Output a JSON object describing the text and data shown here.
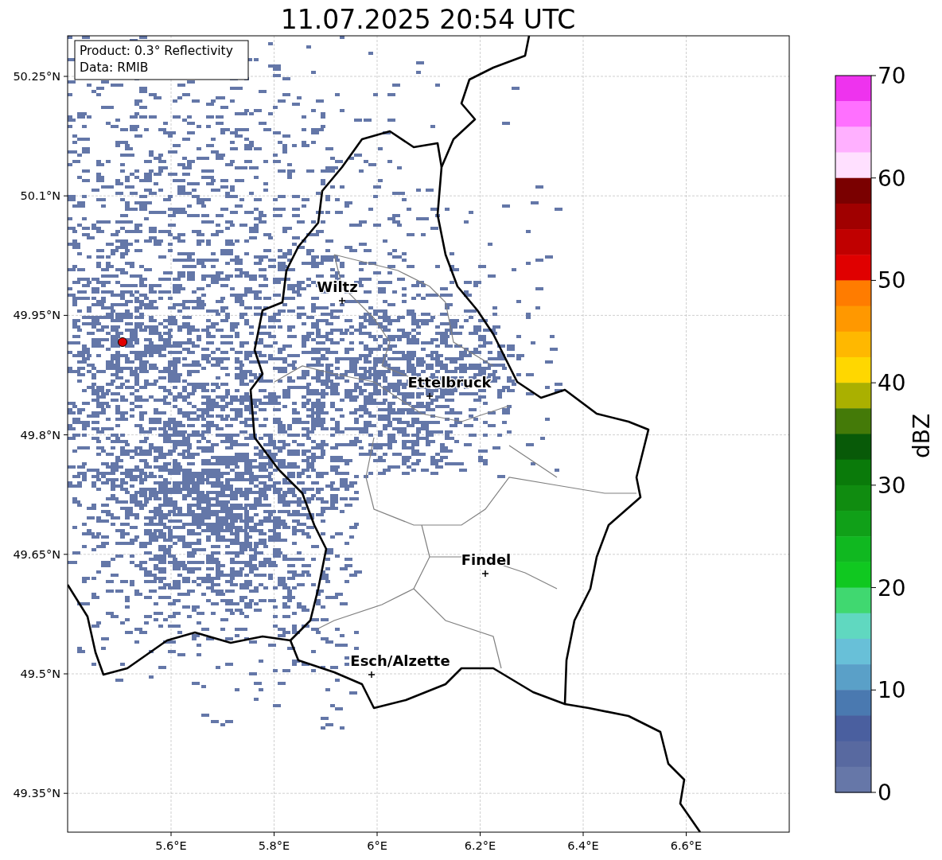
{
  "title": "11.07.2025 20:54 UTC",
  "info_box": [
    "Product: 0.3° Reflectivity",
    "Data: RMIB"
  ],
  "map": {
    "y_ticks": [
      "50.25°N",
      "50.1°N",
      "49.95°N",
      "49.8°N",
      "49.65°N",
      "49.5°N",
      "49.35°N"
    ],
    "x_ticks": [
      "5.6°E",
      "5.8°E",
      "6°E",
      "6.2°E",
      "6.4°E",
      "6.6°E"
    ],
    "places": [
      {
        "name": "Wiltz"
      },
      {
        "name": "Ettelbruck"
      },
      {
        "name": "Findel"
      },
      {
        "name": "Esch/Alzette"
      }
    ]
  },
  "colorbar": {
    "label": "dBZ",
    "ticks": [
      "70",
      "60",
      "50",
      "40",
      "30",
      "20",
      "10",
      "0"
    ],
    "bands": [
      {
        "color": "#ee33ee"
      },
      {
        "color": "#ff70ff"
      },
      {
        "color": "#ffb0ff"
      },
      {
        "color": "#ffe0ff"
      },
      {
        "color": "#7a0000"
      },
      {
        "color": "#a00000"
      },
      {
        "color": "#c00000"
      },
      {
        "color": "#e00000"
      },
      {
        "color": "#ff7c00"
      },
      {
        "color": "#ff9800"
      },
      {
        "color": "#ffb800"
      },
      {
        "color": "#ffd700"
      },
      {
        "color": "#aab000"
      },
      {
        "color": "#447a08"
      },
      {
        "color": "#085a08"
      },
      {
        "color": "#0a7a0a"
      },
      {
        "color": "#108c10"
      },
      {
        "color": "#10a018"
      },
      {
        "color": "#10b820"
      },
      {
        "color": "#10c820"
      },
      {
        "color": "#40d870"
      },
      {
        "color": "#60d8c0"
      },
      {
        "color": "#68c0d8"
      },
      {
        "color": "#5aa0c8"
      },
      {
        "color": "#4a79b0"
      },
      {
        "color": "#4a5f9f"
      },
      {
        "color": "#5869a0"
      },
      {
        "color": "#6677a8"
      }
    ]
  }
}
